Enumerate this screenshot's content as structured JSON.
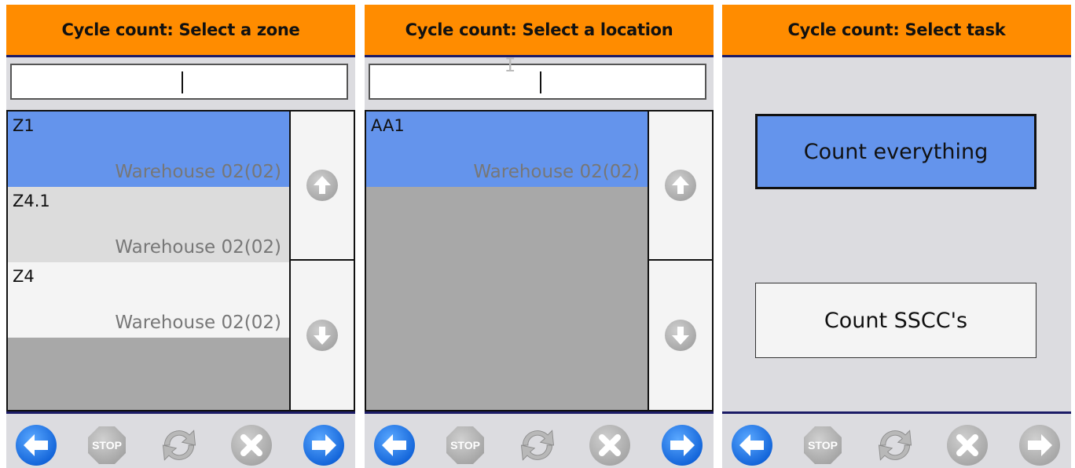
{
  "colors": {
    "header_bg": "#ff8c00",
    "divider": "#1b1b66",
    "selected_bg": "#6494ec",
    "panel_bg": "#dcdce0",
    "active_nav_blue": "#1a6fe8",
    "disabled_gray": "#b4b4b4"
  },
  "zones_panel": {
    "title": "Cycle count: Select a zone",
    "search": {
      "value": "",
      "placeholder": ""
    },
    "items": [
      {
        "code": "Z1",
        "warehouse": "Warehouse 02(02)",
        "state": "selected"
      },
      {
        "code": "Z4.1",
        "warehouse": "Warehouse 02(02)",
        "state": "normal"
      },
      {
        "code": "Z4",
        "warehouse": "Warehouse 02(02)",
        "state": "normal"
      }
    ],
    "scroll_icons": [
      "arrow-up-icon",
      "arrow-down-icon"
    ],
    "footer": [
      "back-arrow-icon",
      "stop-icon",
      "refresh-icon",
      "cancel-icon",
      "forward-arrow-icon"
    ]
  },
  "locations_panel": {
    "title": "Cycle count: Select a location",
    "search": {
      "value": "",
      "placeholder": ""
    },
    "items": [
      {
        "code": "AA1",
        "warehouse": "Warehouse 02(02)",
        "state": "selected"
      }
    ],
    "scroll_icons": [
      "arrow-up-icon",
      "arrow-down-icon"
    ],
    "footer": [
      "back-arrow-icon",
      "stop-icon",
      "refresh-icon",
      "cancel-icon",
      "forward-arrow-icon"
    ]
  },
  "task_panel": {
    "title": "Cycle count: Select task",
    "buttons": [
      {
        "label": "Count everything",
        "state": "selected"
      },
      {
        "label": "Count SSCC's",
        "state": "normal"
      }
    ],
    "footer": [
      "back-arrow-icon",
      "stop-icon",
      "refresh-icon",
      "cancel-icon",
      "forward-arrow-icon"
    ]
  },
  "footer_labels": {
    "stop": "STOP"
  }
}
